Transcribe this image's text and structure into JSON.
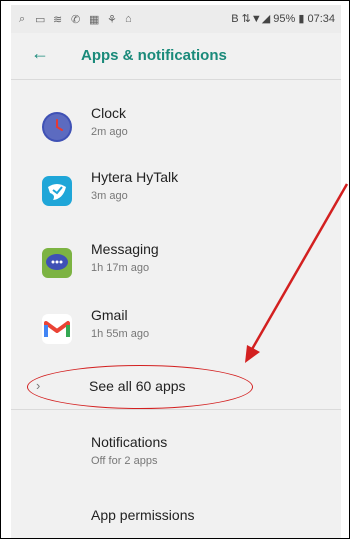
{
  "status_bar": {
    "left_icons": [
      "search-icon",
      "screenshot-icon",
      "signal-icon",
      "phone-icon",
      "calendar-icon",
      "link-icon",
      "lock-icon"
    ],
    "right_text": "B ⇅▼◢ 95% ▮ 07:34"
  },
  "header": {
    "title": "Apps & notifications"
  },
  "recent_apps": [
    {
      "name": "Clock",
      "time": "2m ago",
      "icon": "clock-icon",
      "color": "#3f51b5"
    },
    {
      "name": "Hytera HyTalk",
      "time": "3m ago",
      "icon": "hytalk-icon",
      "color": "#1fa6d8"
    },
    {
      "name": "Messaging",
      "time": "1h 17m ago",
      "icon": "messaging-icon",
      "color": "#7cb342"
    },
    {
      "name": "Gmail",
      "time": "1h 55m ago",
      "icon": "gmail-icon",
      "color": "#ea4335"
    }
  ],
  "see_all": {
    "label": "See all 60 apps"
  },
  "notifications": {
    "label": "Notifications",
    "sub": "Off for 2 apps"
  },
  "app_permissions": {
    "label": "App permissions"
  },
  "annotation": {
    "color": "#d32020"
  }
}
